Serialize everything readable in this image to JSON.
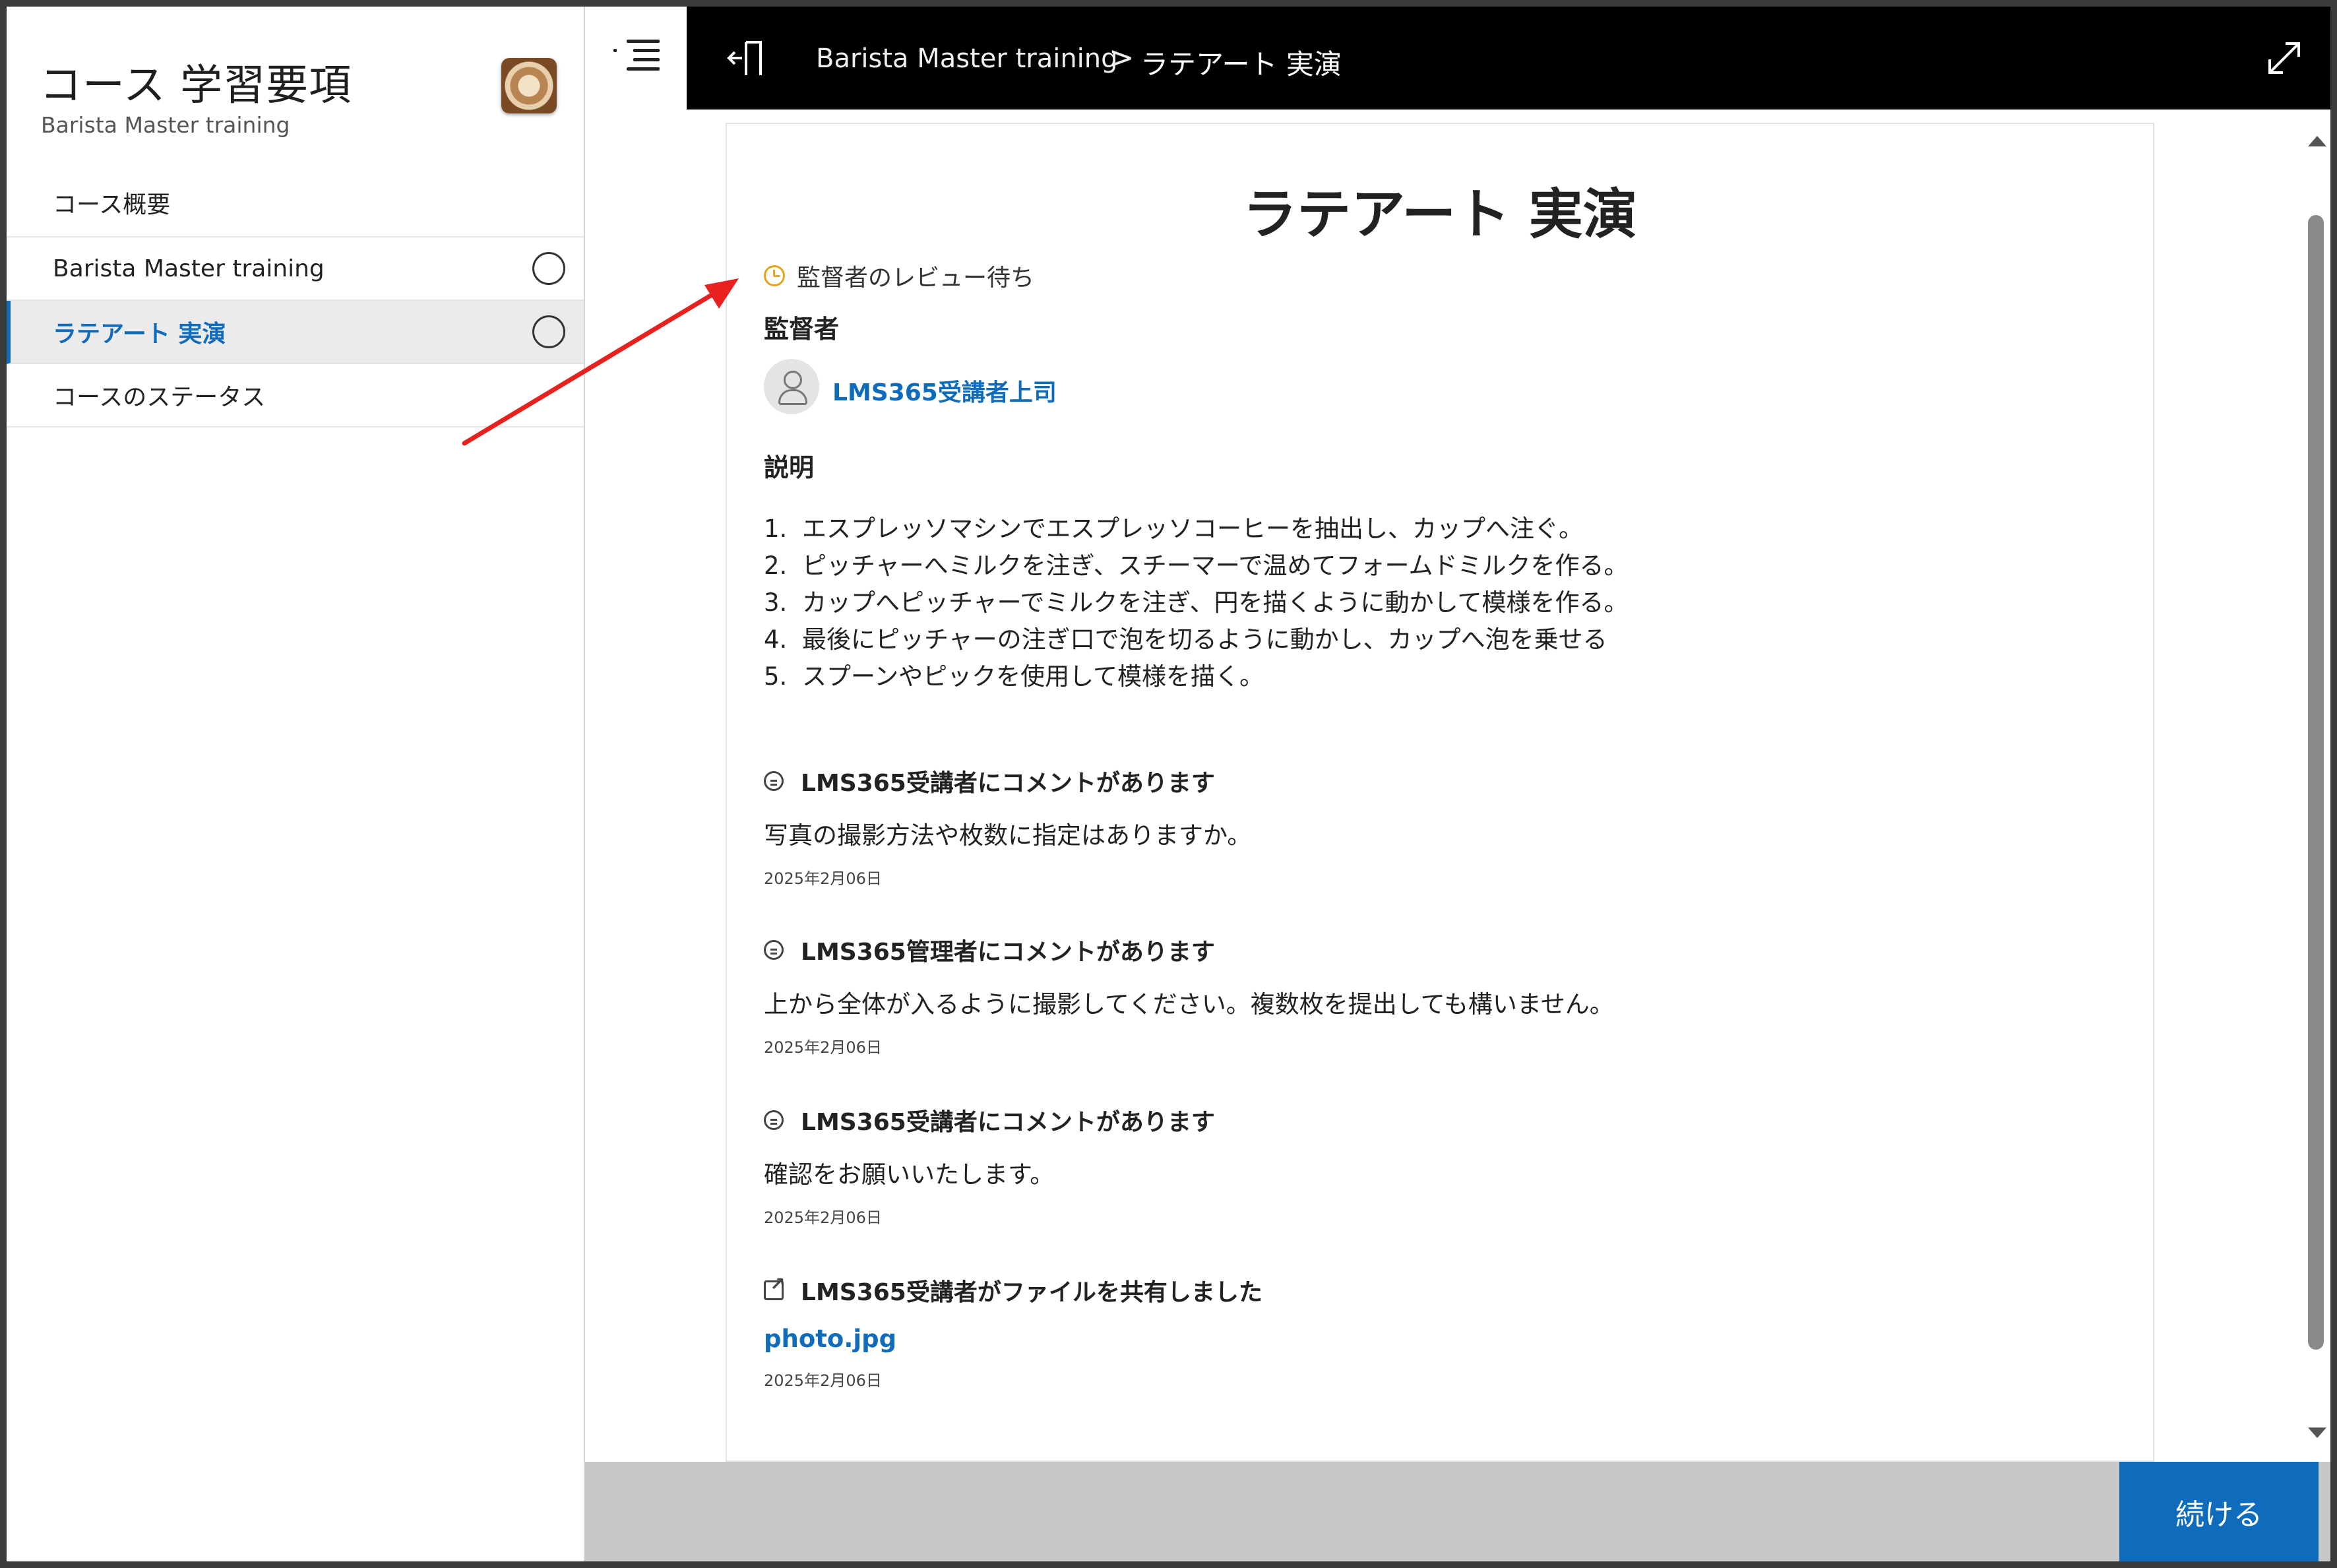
{
  "sidebar": {
    "title": "コース 学習要項",
    "subtitle": "Barista Master training",
    "items": [
      {
        "label": "コース概要"
      },
      {
        "label": "Barista Master training"
      },
      {
        "label": "ラテアート 実演"
      },
      {
        "label": "コースのステータス"
      }
    ]
  },
  "topbar": {
    "breadcrumb_course": "Barista Master training",
    "breadcrumb_separator": ">",
    "breadcrumb_current": "ラテアート 実演"
  },
  "main": {
    "title": "ラテアート 実演",
    "status": "監督者のレビュー待ち",
    "supervisor_label": "監督者",
    "supervisor_name": "LMS365受講者上司",
    "description_label": "説明",
    "steps": [
      {
        "n": "1.",
        "text": "エスプレッソマシンでエスプレッソコーヒーを抽出し、カップへ注ぐ。"
      },
      {
        "n": "2.",
        "text": "ピッチャーへミルクを注ぎ、スチーマーで温めてフォームドミルクを作る。"
      },
      {
        "n": "3.",
        "text": "カップへピッチャーでミルクを注ぎ、円を描くように動かして模様を作る。"
      },
      {
        "n": "4.",
        "text": "最後にピッチャーの注ぎ口で泡を切るように動かし、カップへ泡を乗せる"
      },
      {
        "n": "5.",
        "text": "スプーンやピックを使用して模様を描く。"
      }
    ],
    "activity": [
      {
        "heading": "LMS365受講者にコメントがあります",
        "body": "写真の撮影方法や枚数に指定はありますか。",
        "date": "2025年2月06日"
      },
      {
        "heading": "LMS365管理者にコメントがあります",
        "body": "上から全体が入るように撮影してください。複数枚を提出しても構いません。",
        "date": "2025年2月06日"
      },
      {
        "heading": "LMS365受講者にコメントがあります",
        "body": "確認をお願いいたします。",
        "date": "2025年2月06日"
      },
      {
        "heading": "LMS365受講者がファイルを共有しました",
        "file": "photo.jpg",
        "date": "2025年2月06日"
      }
    ]
  },
  "footer": {
    "continue_label": "続ける"
  },
  "colors": {
    "accent": "#0f6cbd",
    "status_pending": "#e8a317",
    "annotation_arrow": "#e82020",
    "topbar_bg": "#000000"
  },
  "icons": [
    "menu-icon",
    "exit-icon",
    "expand-icon",
    "clock-icon",
    "avatar-icon",
    "comment-icon",
    "share-icon"
  ]
}
